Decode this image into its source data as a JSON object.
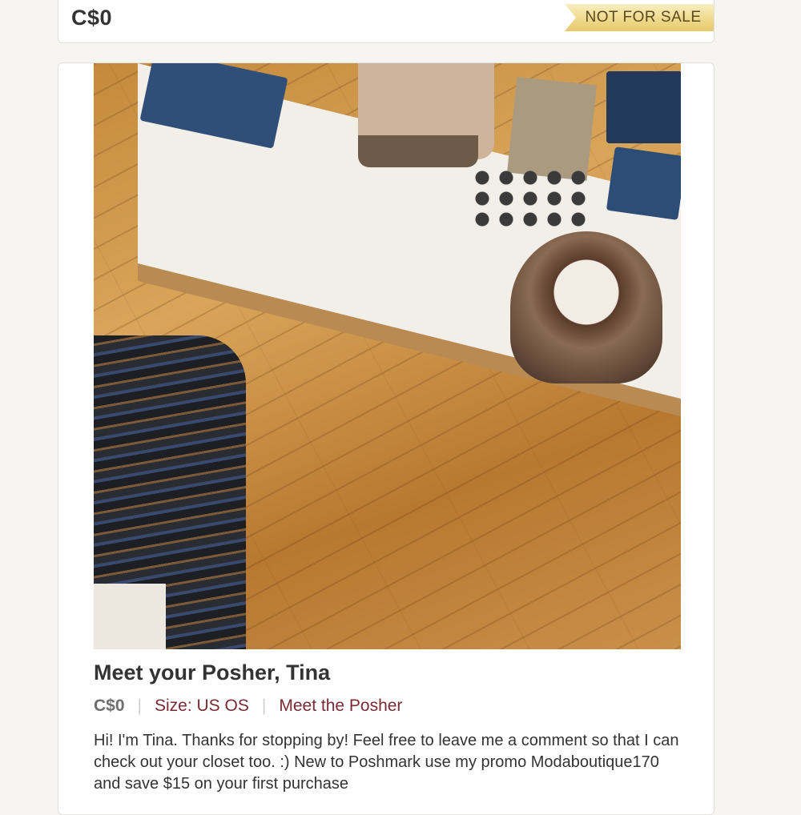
{
  "listing_header": {
    "price": "C$0",
    "badge": "NOT FOR SALE"
  },
  "listing": {
    "title": "Meet your Posher, Tina",
    "price": "C$0",
    "size": "Size: US OS",
    "meet_link": "Meet the Posher",
    "description": "Hi! I'm Tina. Thanks for stopping by! Feel free to leave me a comment so that I can check out your closet too. :)   New to Poshmark use my promo Moda​boutique170 and save $15 on  your first purchase"
  },
  "colors": {
    "accent": "#7a2a33",
    "badge_gold": "#efd98c",
    "text": "#333333"
  }
}
